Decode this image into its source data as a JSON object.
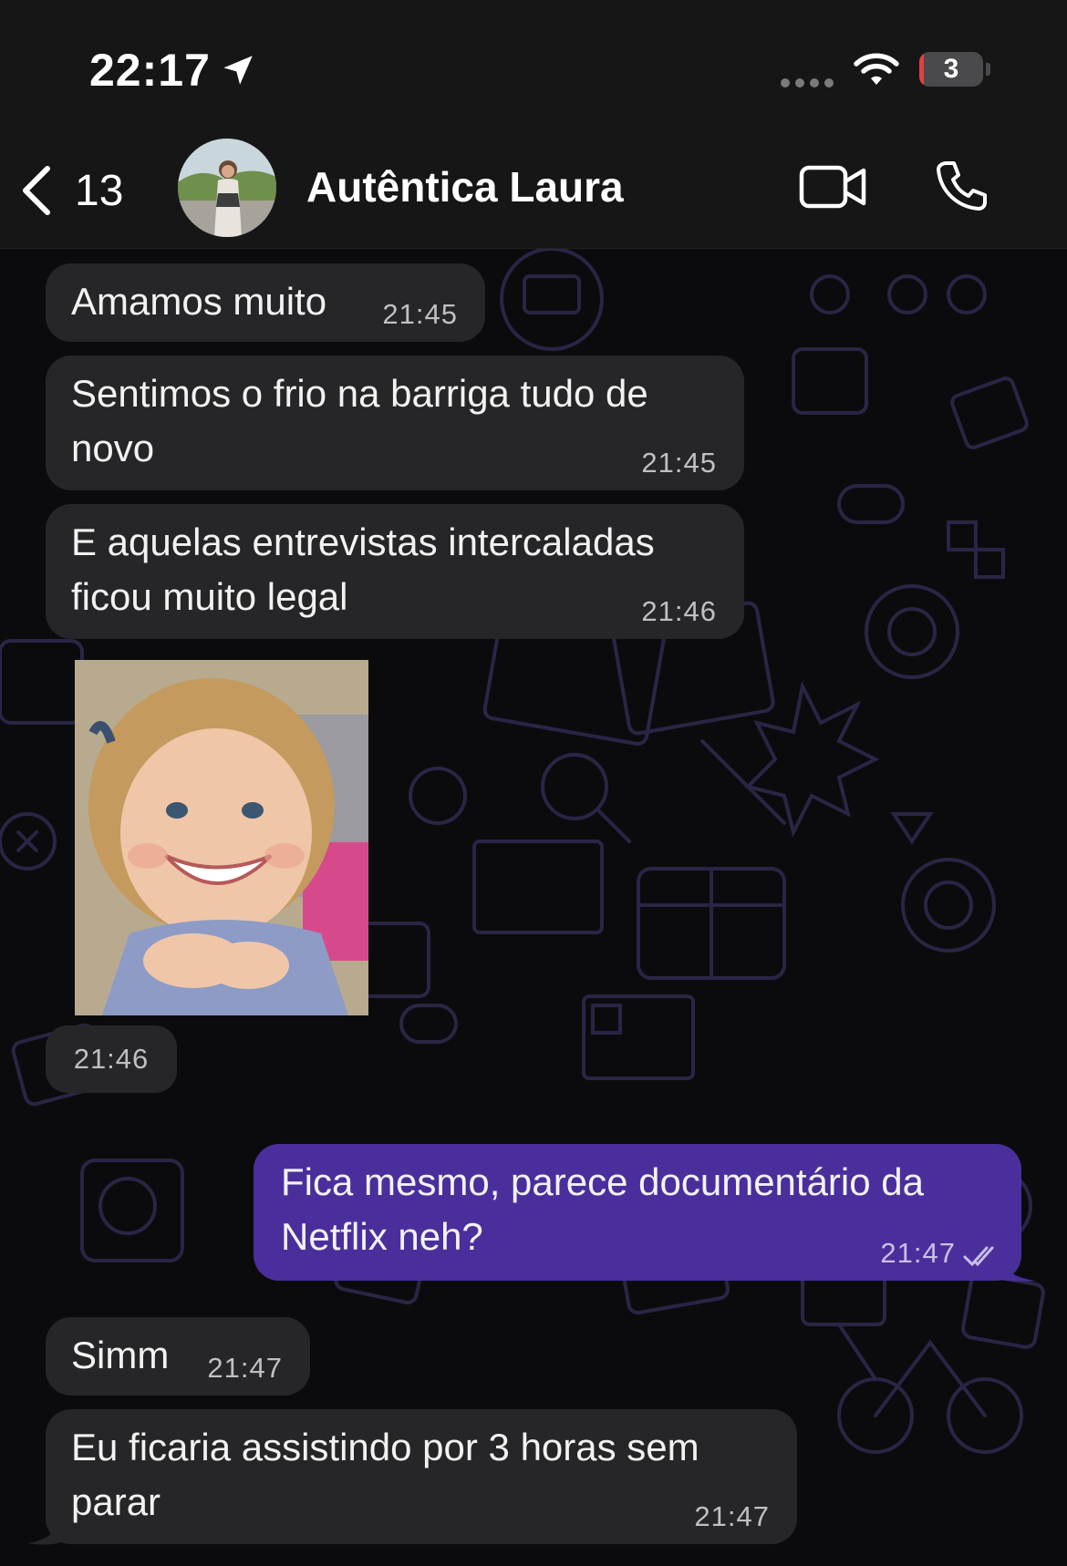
{
  "status_bar": {
    "time": "22:17",
    "battery_level": "3",
    "icons": [
      "location-arrow-icon",
      "signal-icon",
      "wifi-icon",
      "battery-icon"
    ]
  },
  "header": {
    "back_count": "13",
    "contact_name": "Autêntica Laura",
    "icons": [
      "chevron-left-icon",
      "video-call-icon",
      "phone-icon"
    ]
  },
  "messages": [
    {
      "direction": "incoming",
      "text": "Amamos muito",
      "time": "21:45"
    },
    {
      "direction": "incoming",
      "text": "Sentimos o frio na barriga tudo de novo",
      "time": "21:45"
    },
    {
      "direction": "incoming",
      "text": "E aquelas entrevistas intercaladas ficou muito legal",
      "time": "21:46"
    },
    {
      "direction": "incoming",
      "type": "photo",
      "time": "21:46"
    },
    {
      "direction": "outgoing",
      "text": "Fica mesmo, parece documentário da Netflix neh?",
      "time": "21:47",
      "status": "read"
    },
    {
      "direction": "incoming",
      "text": "Simm",
      "time": "21:47"
    },
    {
      "direction": "incoming",
      "text": "Eu ficaria assistindo por 3 horas sem parar",
      "time": "21:47"
    }
  ],
  "colors": {
    "incoming_bubble": "#262628",
    "outgoing_bubble": "#4a2f9c",
    "background": "#0b0b0d",
    "header": "#161617"
  }
}
